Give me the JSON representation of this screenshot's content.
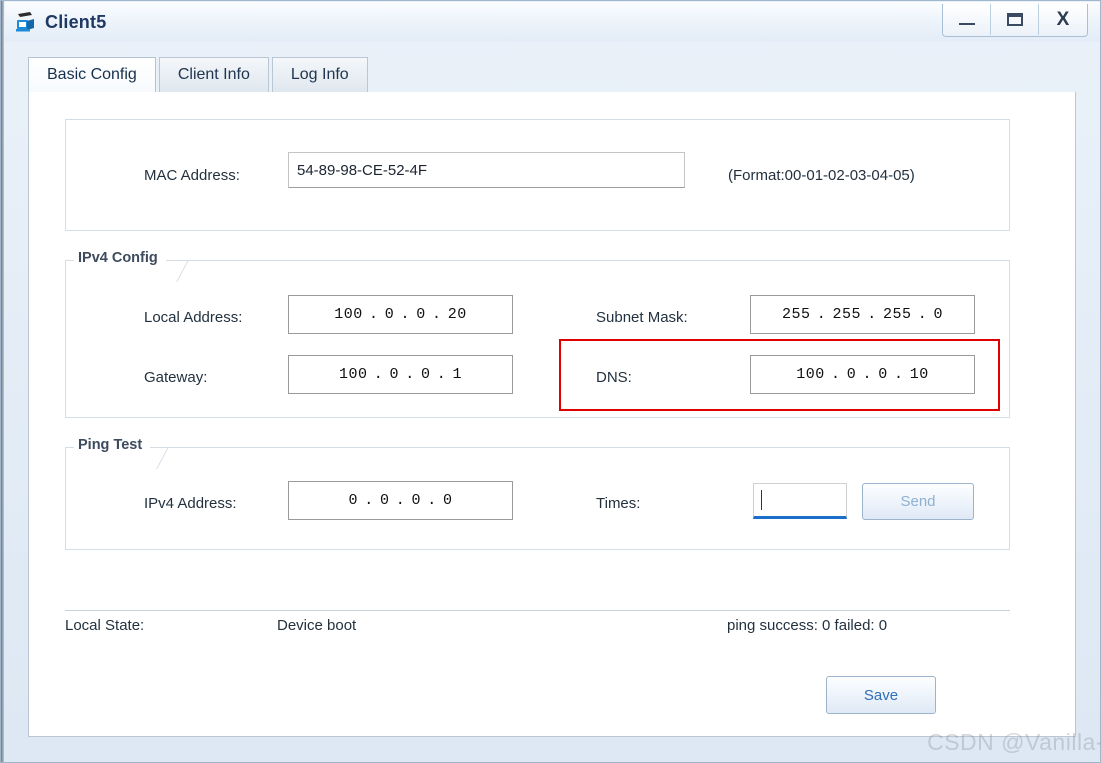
{
  "window": {
    "title": "Client5",
    "icon": "client-device-icon",
    "controls": {
      "minimize": "_",
      "maximize": "▭",
      "close": "X"
    }
  },
  "tabs": [
    {
      "label": "Basic Config",
      "active": true
    },
    {
      "label": "Client Info",
      "active": false
    },
    {
      "label": "Log Info",
      "active": false
    }
  ],
  "mac_section": {
    "label": "MAC Address:",
    "value": "54-89-98-CE-52-4F",
    "format_hint": "(Format:00-01-02-03-04-05)"
  },
  "ipv4_config": {
    "title": "IPv4 Config",
    "local_address": {
      "label": "Local Address:",
      "octets": [
        "100",
        "0",
        "0",
        "20"
      ]
    },
    "gateway": {
      "label": "Gateway:",
      "octets": [
        "100",
        "0",
        "0",
        "1"
      ]
    },
    "subnet_mask": {
      "label": "Subnet Mask:",
      "octets": [
        "255",
        "255",
        "255",
        "0"
      ]
    },
    "dns": {
      "label": "DNS:",
      "octets": [
        "100",
        "0",
        "0",
        "10"
      ],
      "highlighted": true,
      "highlight_color": "#e00000"
    }
  },
  "ping_test": {
    "title": "Ping Test",
    "ipv4_address": {
      "label": "IPv4 Address:",
      "octets": [
        "0",
        "0",
        "0",
        "0"
      ]
    },
    "times": {
      "label": "Times:",
      "value": "",
      "focused": true
    },
    "send_button": "Send"
  },
  "status": {
    "local_state_label": "Local State:",
    "local_state_value": "Device boot",
    "ping_result": "ping success: 0 failed: 0"
  },
  "save_button": "Save",
  "watermark": "CSDN @Vanilla-",
  "colors": {
    "accent_blue": "#2f6fb5",
    "title_text": "#1f3864",
    "highlight_red": "#e00000",
    "focus_underline": "#1c6ecb"
  }
}
